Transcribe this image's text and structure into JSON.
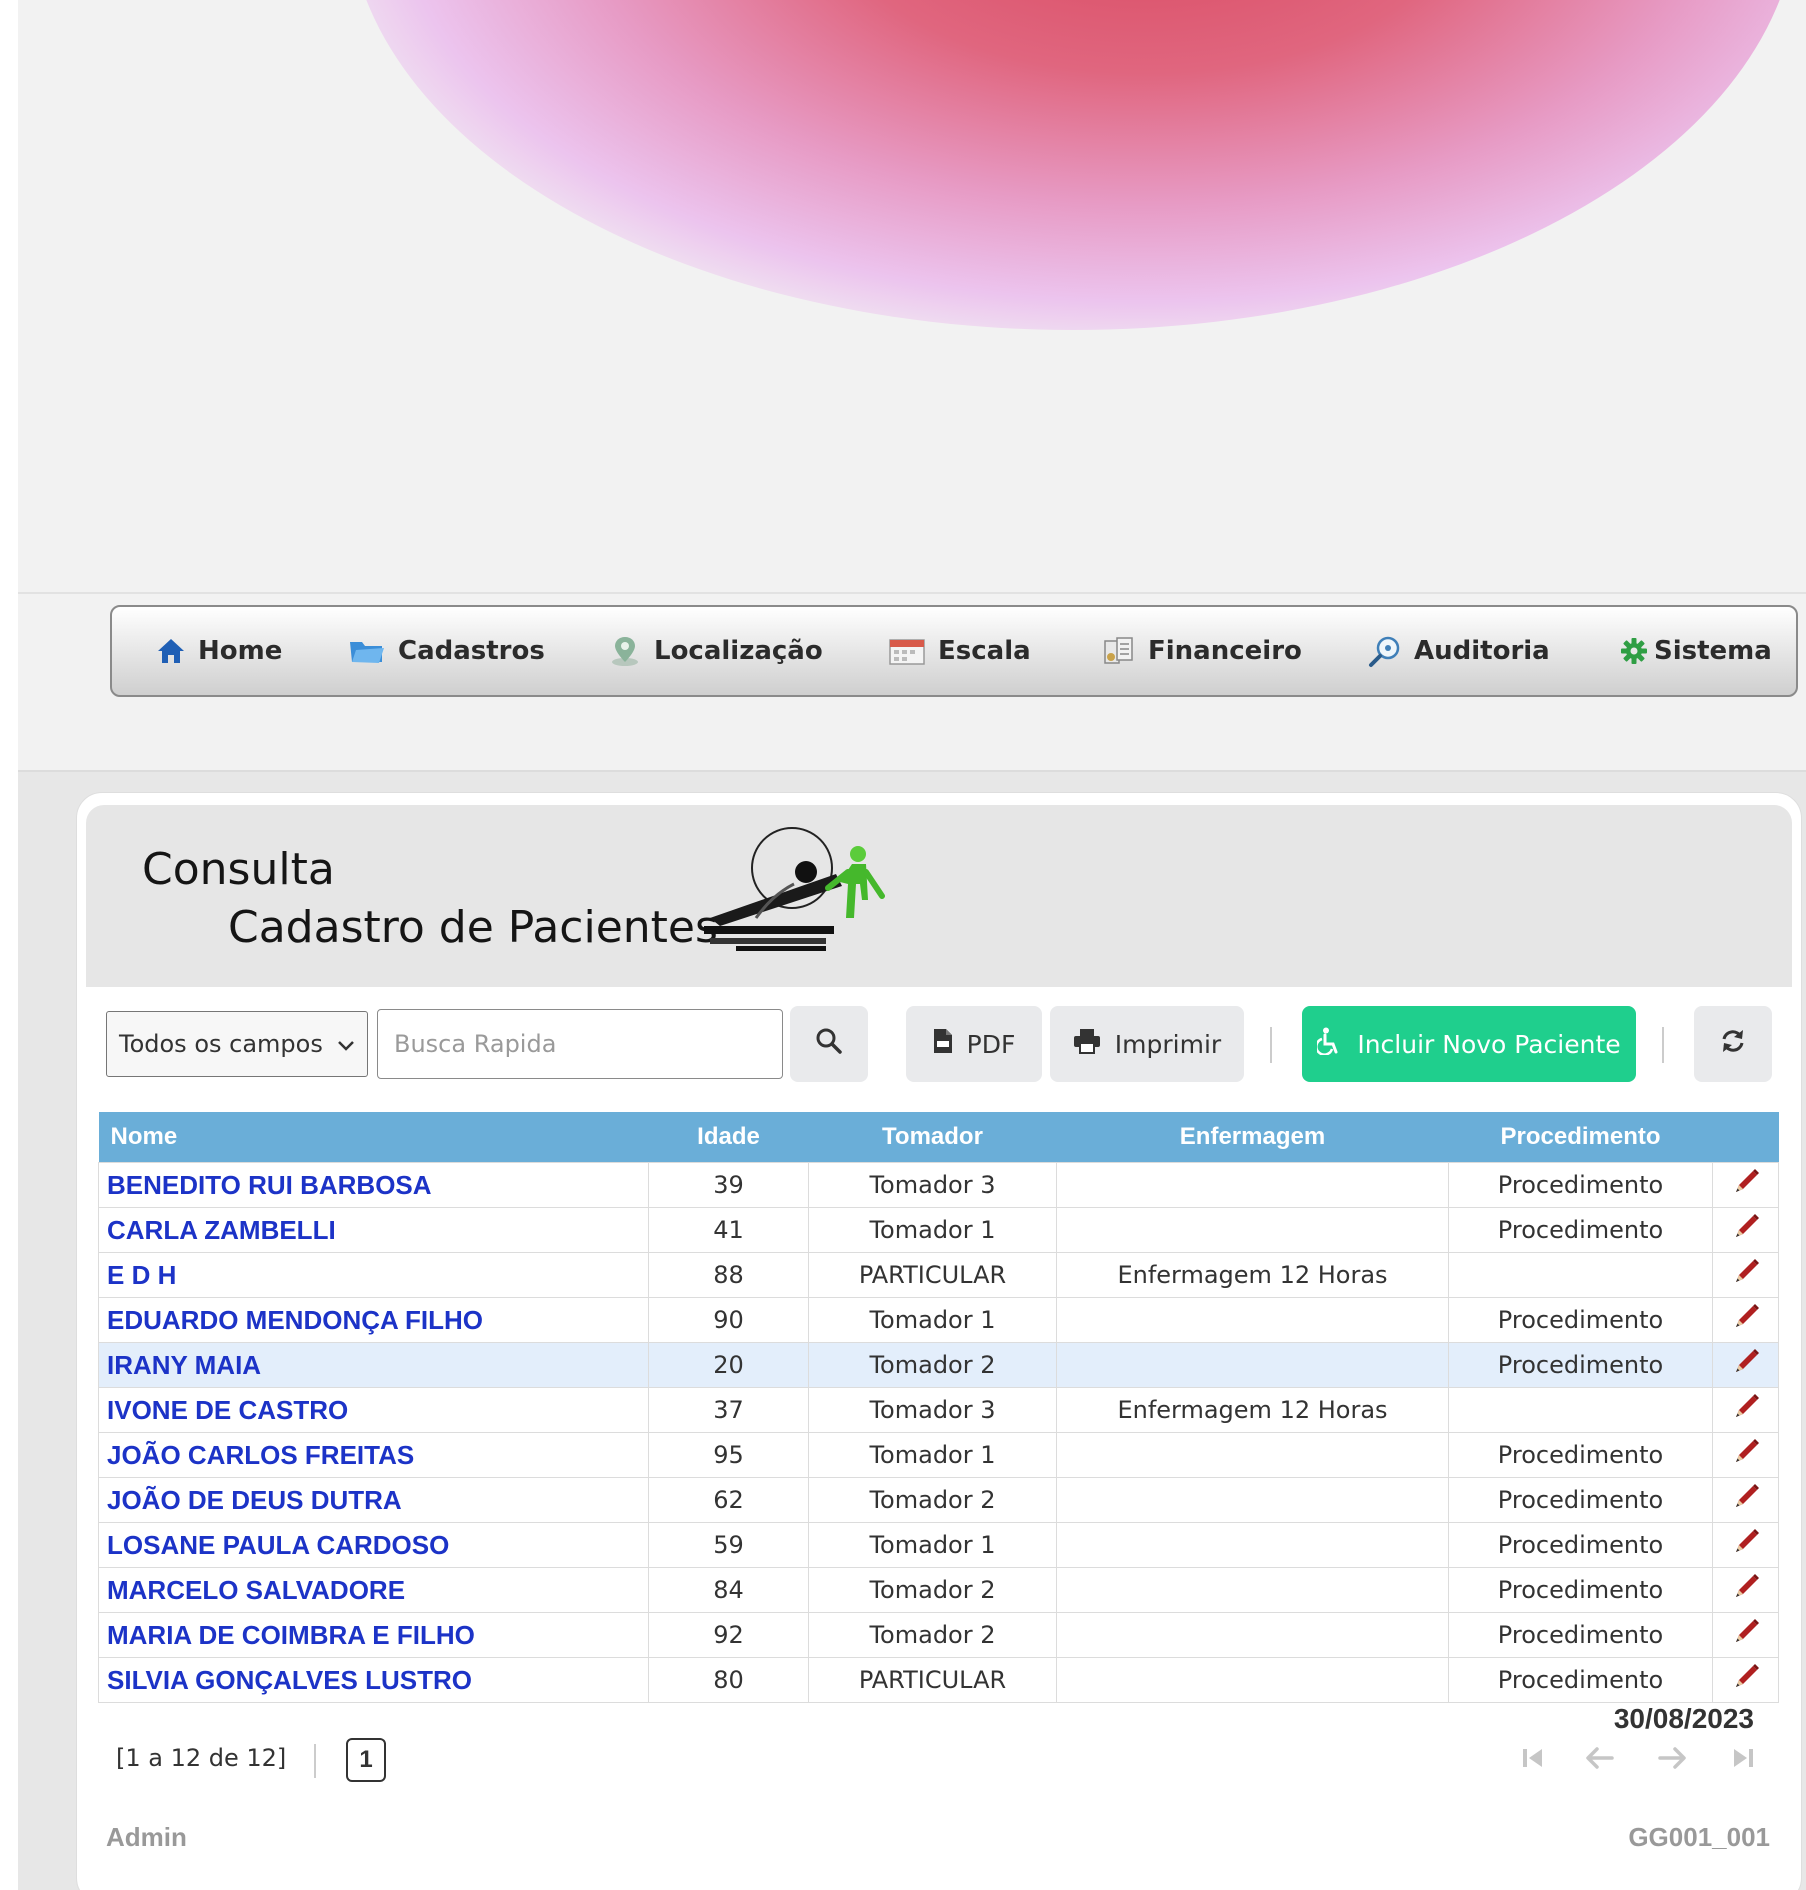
{
  "nav": {
    "items": [
      {
        "label": "Home",
        "icon": "home-icon"
      },
      {
        "label": "Cadastros",
        "icon": "folder-icon"
      },
      {
        "label": "Localização",
        "icon": "location-pin-icon"
      },
      {
        "label": "Escala",
        "icon": "calendar-icon"
      },
      {
        "label": "Financeiro",
        "icon": "finance-icon"
      },
      {
        "label": "Auditoria",
        "icon": "magnifier-icon"
      },
      {
        "label": "Sistema",
        "icon": "gear-icon"
      }
    ]
  },
  "header": {
    "title_line1": "Consulta",
    "title_line2": "Cadastro de Pacientes",
    "date": "30/08/2023"
  },
  "toolbar": {
    "field_select_value": "Todos os campos",
    "search_placeholder": "Busca Rapida",
    "pdf_label": "PDF",
    "print_label": "Imprimir",
    "new_label": "Incluir Novo Paciente"
  },
  "table": {
    "columns": [
      "Nome",
      "Idade",
      "Tomador",
      "Enfermagem",
      "Procedimento"
    ],
    "rows": [
      {
        "nome": "BENEDITO RUI BARBOSA",
        "idade": "39",
        "tomador": "Tomador 3",
        "enfermagem": "",
        "procedimento": "Procedimento"
      },
      {
        "nome": "CARLA ZAMBELLI",
        "idade": "41",
        "tomador": "Tomador 1",
        "enfermagem": "",
        "procedimento": "Procedimento"
      },
      {
        "nome": "E D H",
        "idade": "88",
        "tomador": "PARTICULAR",
        "enfermagem": "Enfermagem 12 Horas",
        "procedimento": ""
      },
      {
        "nome": "EDUARDO MENDONÇA FILHO",
        "idade": "90",
        "tomador": "Tomador 1",
        "enfermagem": "",
        "procedimento": "Procedimento"
      },
      {
        "nome": "IRANY MAIA",
        "idade": "20",
        "tomador": "Tomador 2",
        "enfermagem": "",
        "procedimento": "Procedimento"
      },
      {
        "nome": "IVONE DE CASTRO",
        "idade": "37",
        "tomador": "Tomador 3",
        "enfermagem": "Enfermagem 12 Horas",
        "procedimento": ""
      },
      {
        "nome": "JOÃO CARLOS FREITAS",
        "idade": "95",
        "tomador": "Tomador 1",
        "enfermagem": "",
        "procedimento": "Procedimento"
      },
      {
        "nome": "JOÃO DE DEUS DUTRA",
        "idade": "62",
        "tomador": "Tomador 2",
        "enfermagem": "",
        "procedimento": "Procedimento"
      },
      {
        "nome": "LOSANE PAULA CARDOSO",
        "idade": "59",
        "tomador": "Tomador 1",
        "enfermagem": "",
        "procedimento": "Procedimento"
      },
      {
        "nome": "MARCELO SALVADORE",
        "idade": "84",
        "tomador": "Tomador 2",
        "enfermagem": "",
        "procedimento": "Procedimento"
      },
      {
        "nome": "MARIA DE COIMBRA E FILHO",
        "idade": "92",
        "tomador": "Tomador 2",
        "enfermagem": "",
        "procedimento": "Procedimento"
      },
      {
        "nome": "SILVIA GONÇALVES LUSTRO",
        "idade": "80",
        "tomador": "PARTICULAR",
        "enfermagem": "",
        "procedimento": "Procedimento"
      }
    ]
  },
  "pager": {
    "info": "[1 a 12 de 12]",
    "current_page": "1"
  },
  "footer": {
    "user": "Admin",
    "code": "GG001_001"
  },
  "colors": {
    "header_blue": "#6aaed8",
    "link_blue": "#1c33c7",
    "green_button": "#1fcf8d",
    "highlight_row": "#e3eefb",
    "pencil_red": "#b02020"
  }
}
